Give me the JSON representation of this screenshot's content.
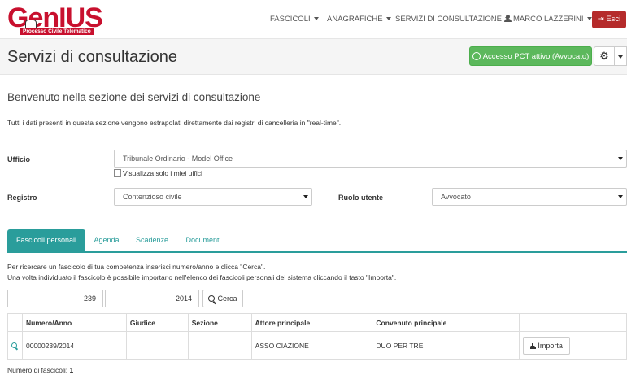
{
  "brand": {
    "logo_text": "GenIUS",
    "logo_subtitle": "Processo Civile Telematico"
  },
  "nav": {
    "items": [
      {
        "label": "FASCICOLI"
      },
      {
        "label": "ANAGRAFICHE"
      },
      {
        "label": "SERVIZI DI CONSULTAZIONE"
      },
      {
        "label": "MARCO LAZZERINI"
      }
    ],
    "logout_label": "Esci"
  },
  "header": {
    "title": "Servizi di consultazione",
    "pct_button_label": "Accesso PCT attivo (Avvocato)"
  },
  "intro": {
    "welcome": "Benvenuto nella sezione dei servizi di consultazione",
    "info": "Tutti i dati presenti in questa sezione vengono estrapolati direttamente dai registri di cancelleria in \"real-time\"."
  },
  "form": {
    "ufficio_label": "Ufficio",
    "ufficio_value": "Tribunale Ordinario - Model Office",
    "only_my_offices_label": "Visualizza solo i miei uffici",
    "registro_label": "Registro",
    "registro_value": "Contenzioso civile",
    "ruolo_label": "Ruolo utente",
    "ruolo_value": "Avvocato"
  },
  "tabs": [
    {
      "label": "Fascicoli personali",
      "active": true
    },
    {
      "label": "Agenda",
      "active": false
    },
    {
      "label": "Scadenze",
      "active": false
    },
    {
      "label": "Documenti",
      "active": false
    }
  ],
  "search": {
    "instruction_1": "Per ricercare un fascicolo di tua competenza inserisci numero/anno e clicca \"Cerca\".",
    "instruction_2": "Una volta individuato il fascicolo è possibile importarlo nell'elenco dei fascicoli personali del sistema cliccando il tasto \"Importa\".",
    "numero": "239",
    "anno": "2014",
    "button_label": "Cerca"
  },
  "table": {
    "headers": [
      "",
      "Numero/Anno",
      "Giudice",
      "Sezione",
      "Attore principale",
      "Convenuto principale",
      ""
    ],
    "rows": [
      {
        "numero_anno": "00000239/2014",
        "giudice": "",
        "sezione": "",
        "attore": "ASSO CIAZIONE",
        "convenuto": "DUO PER TRE",
        "action_label": "Importa"
      }
    ],
    "count_label": "Numero di fascicoli:",
    "count_value": "1"
  },
  "colors": {
    "brand_red": "#c8102e",
    "accent_teal": "#2a9d9b",
    "success_green": "#5cb85c",
    "logout_red": "#b52b2b"
  }
}
